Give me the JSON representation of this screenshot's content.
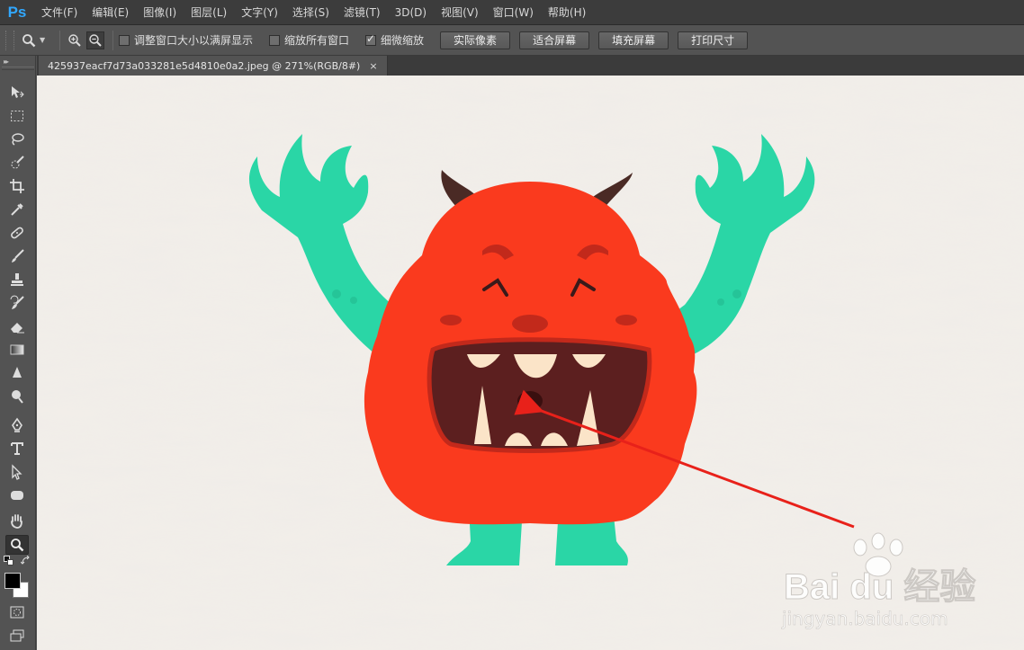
{
  "app": {
    "logo": "Ps"
  },
  "menu": [
    "文件(F)",
    "编辑(E)",
    "图像(I)",
    "图层(L)",
    "文字(Y)",
    "选择(S)",
    "滤镜(T)",
    "3D(D)",
    "视图(V)",
    "窗口(W)",
    "帮助(H)"
  ],
  "options": {
    "tool_icon": "zoom-icon",
    "zoom_in_icon": "zoom-in-icon",
    "zoom_out_icon": "zoom-out-icon",
    "checkboxes": [
      {
        "label": "调整窗口大小以满屏显示",
        "checked": false
      },
      {
        "label": "缩放所有窗口",
        "checked": false
      },
      {
        "label": "细微缩放",
        "checked": true
      }
    ],
    "buttons": [
      "实际像素",
      "适合屏幕",
      "填充屏幕",
      "打印尺寸"
    ]
  },
  "document": {
    "tab_title": "425937eacf7d73a033281e5d4810e0a2.jpeg @ 271%(RGB/8#)",
    "close_glyph": "×"
  },
  "watermark": {
    "brand": "Bai du 经验",
    "url": "jingyan.baidu.com"
  },
  "colors": {
    "monster_body": "#fa3a1e",
    "monster_arms": "#2ad6a6",
    "mouth": "#5c1f1f",
    "arrow": "#e8211a",
    "canvas_bg": "#f2eee9",
    "ps_blue": "#31a8ff"
  }
}
